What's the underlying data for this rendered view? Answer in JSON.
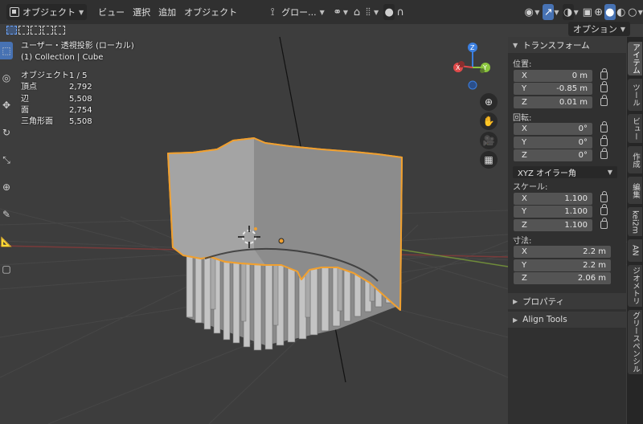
{
  "header": {
    "mode": "オブジェクト",
    "menus": [
      "ビュー",
      "選択",
      "追加",
      "オブジェクト"
    ],
    "transform_orientation": "グロー...",
    "options_label": "オプション"
  },
  "viewport": {
    "view_name": "ユーザー・透視投影 (ローカル)",
    "collection": "(1) Collection | Cube",
    "stats": [
      {
        "key": "オブジェクト",
        "value": "1 / 5"
      },
      {
        "key": "頂点",
        "value": "2,792"
      },
      {
        "key": "辺",
        "value": "5,508"
      },
      {
        "key": "面",
        "value": "2,754"
      },
      {
        "key": "三角形面",
        "value": "5,508"
      }
    ]
  },
  "npanel": {
    "transform_header": "トランスフォーム",
    "location_label": "位置:",
    "location": [
      {
        "axis": "X",
        "value": "0 m"
      },
      {
        "axis": "Y",
        "value": "-0.85 m"
      },
      {
        "axis": "Z",
        "value": "0.01 m"
      }
    ],
    "rotation_label": "回転:",
    "rotation": [
      {
        "axis": "X",
        "value": "0°"
      },
      {
        "axis": "Y",
        "value": "0°"
      },
      {
        "axis": "Z",
        "value": "0°"
      }
    ],
    "rotation_mode": "XYZ オイラー角",
    "scale_label": "スケール:",
    "scale": [
      {
        "axis": "X",
        "value": "1.100"
      },
      {
        "axis": "Y",
        "value": "1.100"
      },
      {
        "axis": "Z",
        "value": "1.100"
      }
    ],
    "dimensions_label": "寸法:",
    "dimensions": [
      {
        "axis": "X",
        "value": "2.2 m"
      },
      {
        "axis": "Y",
        "value": "2.2 m"
      },
      {
        "axis": "Z",
        "value": "2.06 m"
      }
    ],
    "properties_header": "プロパティ",
    "align_tools_header": "Align Tools"
  },
  "tabs": [
    "アイテム",
    "ツール",
    "ビュー",
    "作成",
    "編集",
    "kei2m",
    "AN",
    "ジオメトリ",
    "グリースペンシル"
  ],
  "gizmo_axes": [
    "Z",
    "Y",
    "X"
  ],
  "colors": {
    "accent": "#4772b3",
    "selection_outline": "#f0a030",
    "x_axis": "#e04a4a",
    "y_axis": "#8cc63f",
    "z_axis": "#3b7fe0"
  }
}
